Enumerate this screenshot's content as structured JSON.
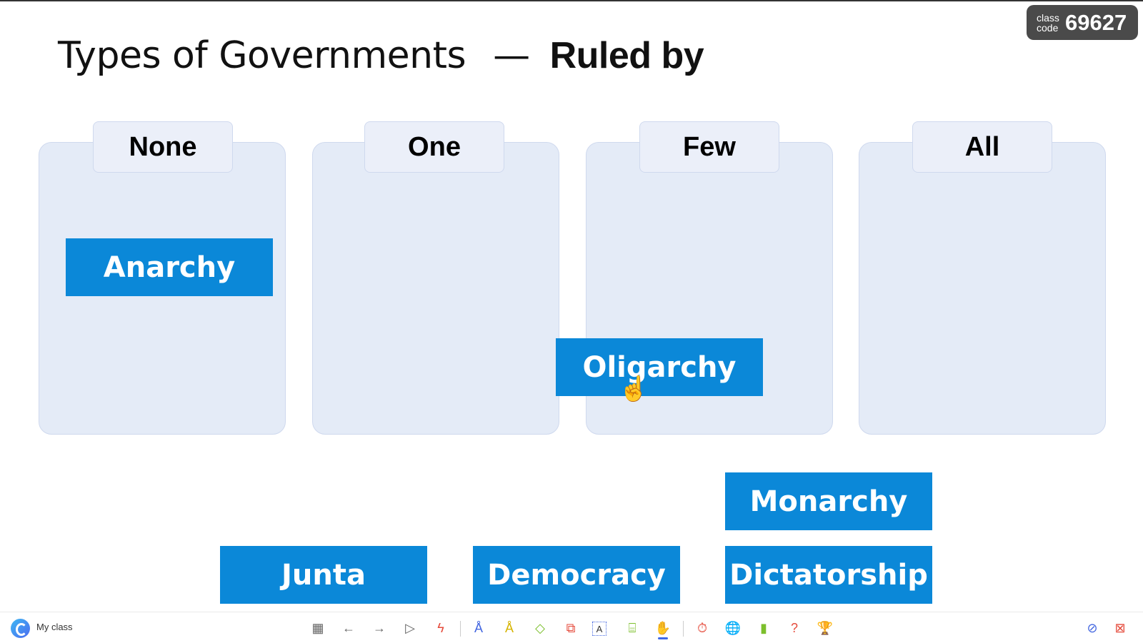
{
  "title": {
    "main": "Types of Governments",
    "separator": "—",
    "emphasis": "Ruled by"
  },
  "class_code": {
    "label_line1": "class",
    "label_line2": "code",
    "code": "69627"
  },
  "bins": [
    {
      "label": "None"
    },
    {
      "label": "One"
    },
    {
      "label": "Few"
    },
    {
      "label": "All"
    }
  ],
  "cards": {
    "anarchy": "Anarchy",
    "oligarchy": "Oligarchy",
    "monarchy": "Monarchy",
    "junta": "Junta",
    "democracy": "Democracy",
    "dictatorship": "Dictatorship"
  },
  "colors": {
    "card": "#0b88d8",
    "bin": "#e4ebf7",
    "badge": "#4a4a4a"
  },
  "toolbar": {
    "app_label": "My class",
    "icons": [
      "grid-icon",
      "arrow-left-icon",
      "arrow-right-icon",
      "pointer-icon",
      "laser-pen-icon",
      "pen-icon",
      "highlighter-icon",
      "eraser-icon",
      "shapes-icon",
      "text-box-icon",
      "whiteboard-icon",
      "hand-interact-icon",
      "timer-icon",
      "browser-search-icon",
      "poll-chart-icon",
      "random-pick-icon",
      "trophy-icon",
      "hide-icon",
      "end-presentation-icon"
    ]
  }
}
